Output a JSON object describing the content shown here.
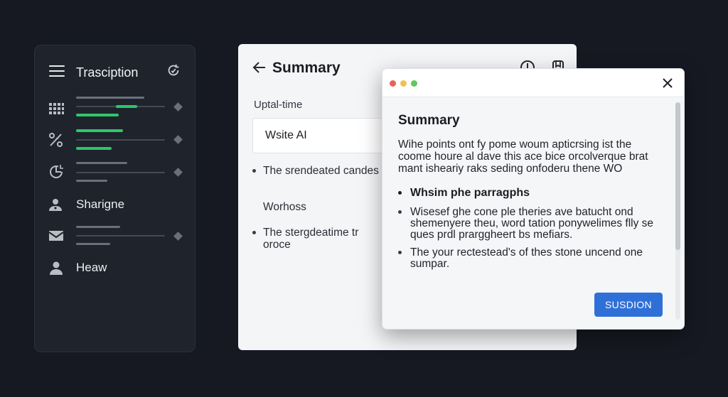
{
  "sidebar": {
    "title": "Trasciption",
    "items": [
      {
        "icon": "grid-icon",
        "type": "bars"
      },
      {
        "icon": "percent-icon",
        "type": "bars"
      },
      {
        "icon": "chart-refresh-icon",
        "type": "bars"
      },
      {
        "icon": "user-group-icon",
        "type": "label",
        "label": "Sharigne"
      },
      {
        "icon": "mail-icon",
        "type": "bars"
      },
      {
        "icon": "user-icon",
        "type": "label",
        "label": "Heaw"
      }
    ]
  },
  "main_panel": {
    "title": "Summary",
    "field_label": "Uptal-time",
    "field_value": "Wsite AI",
    "bullets": [
      "The srendeated candes",
      "The stergdeatime tr oroce"
    ],
    "plain_text": "Worhoss"
  },
  "dialog": {
    "heading": "Summary",
    "paragraph": "Wihe points ont fy pome woum apticrsing ist the coome houre al dave this ace bice orcolverque brat mant isheariy raks seding onfoderu thene WO",
    "section_heading": "Whsim phe parragphs",
    "items": [
      "Wisesef ghe cone ple theries ave batucht ond shemenyere theu, word tation ponywelimes flly se ques prdl prarggheert bs mefiars.",
      "The your rectestead's of thes stone uncend one sumpar."
    ],
    "primary_button": "SUSDION",
    "colors": {
      "close": "#ec5f57",
      "minimize": "#f4bf4f",
      "maximize": "#5fc95a",
      "primary": "#2f6fd8"
    }
  },
  "colors": {
    "accent_green": "#2ec66a",
    "background": "#161922"
  }
}
